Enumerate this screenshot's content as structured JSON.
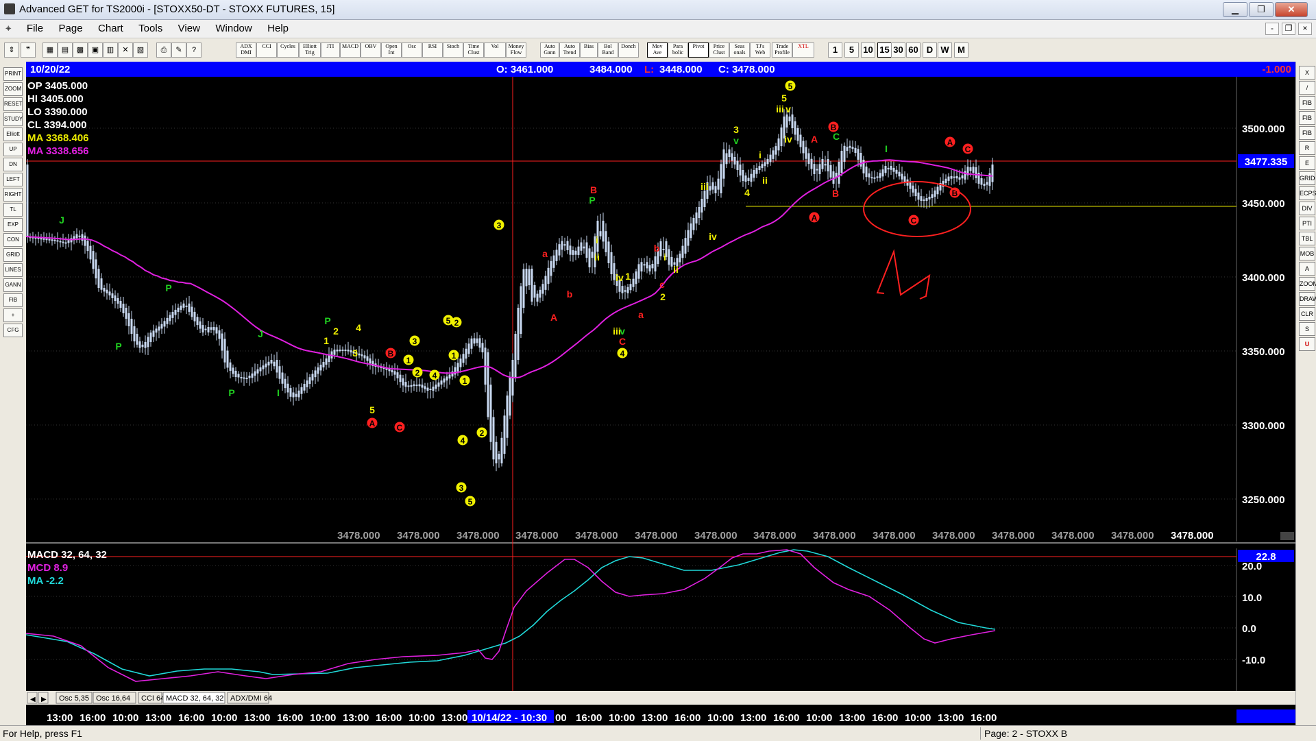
{
  "window": {
    "title": "Advanced GET for TS2000i - [STOXX50-DT - STOXX FUTURES, 15]",
    "controls": [
      "▁",
      "❐",
      "✕"
    ]
  },
  "menu": {
    "items": [
      "File",
      "Page",
      "Chart",
      "Tools",
      "View",
      "Window",
      "Help"
    ],
    "doc_controls": [
      "-",
      "❐",
      "×"
    ]
  },
  "toolbar": {
    "indicators": [
      "ADX DMI",
      "CCI",
      "Cycles",
      "Elliott Trig",
      "JTI",
      "MACD",
      "OBV",
      "Open Int",
      "Osc",
      "RSI",
      "Stoch",
      "Time Clust",
      "Vol",
      "Money Flow",
      "Auto Gann",
      "Auto Trend",
      "Bias",
      "Bol Band",
      "Donch",
      "Mov Ave",
      "Para bolic",
      "Pivot",
      "Price Clust",
      "Seas onals",
      "TJ's Web",
      "Trade Profile",
      "XTL"
    ],
    "timeframes": [
      "1",
      "5",
      "10",
      "15",
      "30",
      "60",
      "D",
      "W",
      "M"
    ],
    "active_timeframe": "15"
  },
  "left_tools": [
    "PRINT",
    "ZOOM",
    "RESET",
    "STUDY",
    "Elliott",
    "UP",
    "DN",
    "LEFT",
    "RIGHT",
    "TL",
    "EXP",
    "CON",
    "GRID",
    "LINES",
    "GANN",
    "FIB",
    "+",
    "CFG"
  ],
  "right_tools": [
    "X",
    "/",
    "FIB RET",
    "FIB EXT",
    "FIB TIME",
    "R",
    "E",
    "GRID",
    "ECPS",
    "DIV",
    "PTI",
    "TBL",
    "MOB",
    "A",
    "ZOOM",
    "DRAW",
    "CLR",
    "S",
    "U"
  ],
  "header": {
    "date": "10/20/22",
    "open": "O: 3461.000",
    "high": "3484.000",
    "low_label": "L:",
    "low": "3448.000",
    "close": "C: 3478.000",
    "change": "-1.000"
  },
  "info_panel": {
    "op": "OP 3405.000",
    "hi": "HI  3405.000",
    "lo": "LO  3390.000",
    "cl": "CL  3394.000",
    "ma1": "MA  3368.406",
    "ma2": "MA  3338.656"
  },
  "price_axis": {
    "ticks": [
      "3500.000",
      "3450.000",
      "3400.000",
      "3350.000",
      "3300.000",
      "3250.000"
    ],
    "current": "3477.335"
  },
  "bottom_values": [
    "3478.000",
    "3478.000",
    "3478.000",
    "3478.000",
    "3478.000",
    "3478.000",
    "3478.000",
    "3478.000",
    "3478.000",
    "3478.000",
    "3478.000",
    "3478.000",
    "3478.000",
    "3478.000",
    "3478.000"
  ],
  "macd": {
    "title": "MACD 32, 64, 32",
    "mcd": "MCD 8.9",
    "ma": "MA  -2.2",
    "current": "22.8",
    "ticks": [
      "20.0",
      "10.0",
      "0.0",
      "-10.0"
    ]
  },
  "tabs": [
    "Osc 5,35",
    "Osc 16,64",
    "CCI 64",
    "MACD 32, 64, 32",
    "ADX/DMI 64"
  ],
  "time_axis": {
    "labels": [
      "13:00",
      "16:00",
      "10:00",
      "13:00",
      "16:00",
      "10:00",
      "13:00",
      "16:00",
      "10:00",
      "13:00",
      "16:00",
      "10:00",
      "13:00"
    ],
    "cursor": "10/14/22 - 10:30",
    "labels_after": [
      "00",
      "16:00",
      "10:00",
      "13:00",
      "16:00",
      "10:00",
      "13:00",
      "16:00",
      "10:00",
      "13:00",
      "16:00",
      "10:00",
      "13:00",
      "16:00"
    ]
  },
  "status": {
    "left": "For Help, press F1",
    "right": "Page: 2 - STOXX B"
  },
  "colors": {
    "background": "#000000",
    "candles": "#c8d8f0",
    "ma_fast": "#e8e800",
    "ma_slow": "#e020e0",
    "header_bar": "#0000ff",
    "labels_green": "#20d020",
    "labels_yellow": "#f0f000",
    "labels_red": "#ff2020"
  }
}
